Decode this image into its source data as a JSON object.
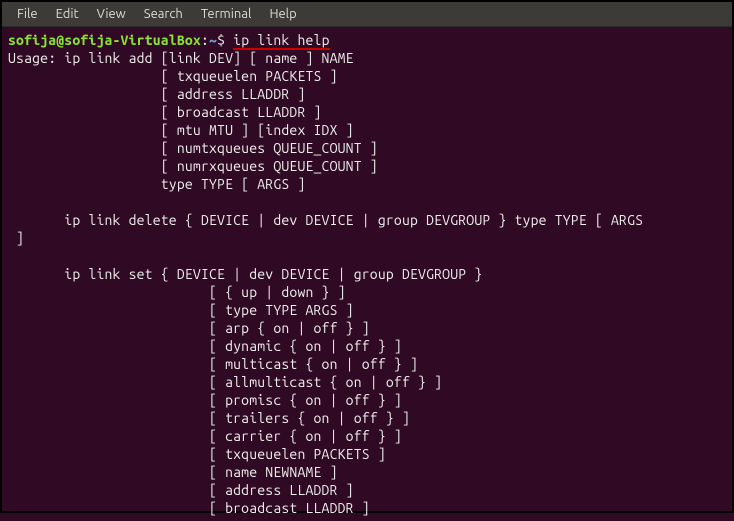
{
  "menu": {
    "file": "File",
    "edit": "Edit",
    "view": "View",
    "search": "Search",
    "terminal": "Terminal",
    "help": "Help"
  },
  "prompt": {
    "user_host": "sofija@sofija-VirtualBox",
    "colon": ":",
    "path": "~",
    "sigil": "$"
  },
  "command": "ip link help",
  "output": "Usage: ip link add [link DEV] [ name ] NAME\n                   [ txqueuelen PACKETS ]\n                   [ address LLADDR ]\n                   [ broadcast LLADDR ]\n                   [ mtu MTU ] [index IDX ]\n                   [ numtxqueues QUEUE_COUNT ]\n                   [ numrxqueues QUEUE_COUNT ]\n                   type TYPE [ ARGS ]\n\n       ip link delete { DEVICE | dev DEVICE | group DEVGROUP } type TYPE [ ARGS\n ]\n\n       ip link set { DEVICE | dev DEVICE | group DEVGROUP }\n                         [ { up | down } ]\n                         [ type TYPE ARGS ]\n                         [ arp { on | off } ]\n                         [ dynamic { on | off } ]\n                         [ multicast { on | off } ]\n                         [ allmulticast { on | off } ]\n                         [ promisc { on | off } ]\n                         [ trailers { on | off } ]\n                         [ carrier { on | off } ]\n                         [ txqueuelen PACKETS ]\n                         [ name NEWNAME ]\n                         [ address LLADDR ]\n                         [ broadcast LLADDR ]"
}
